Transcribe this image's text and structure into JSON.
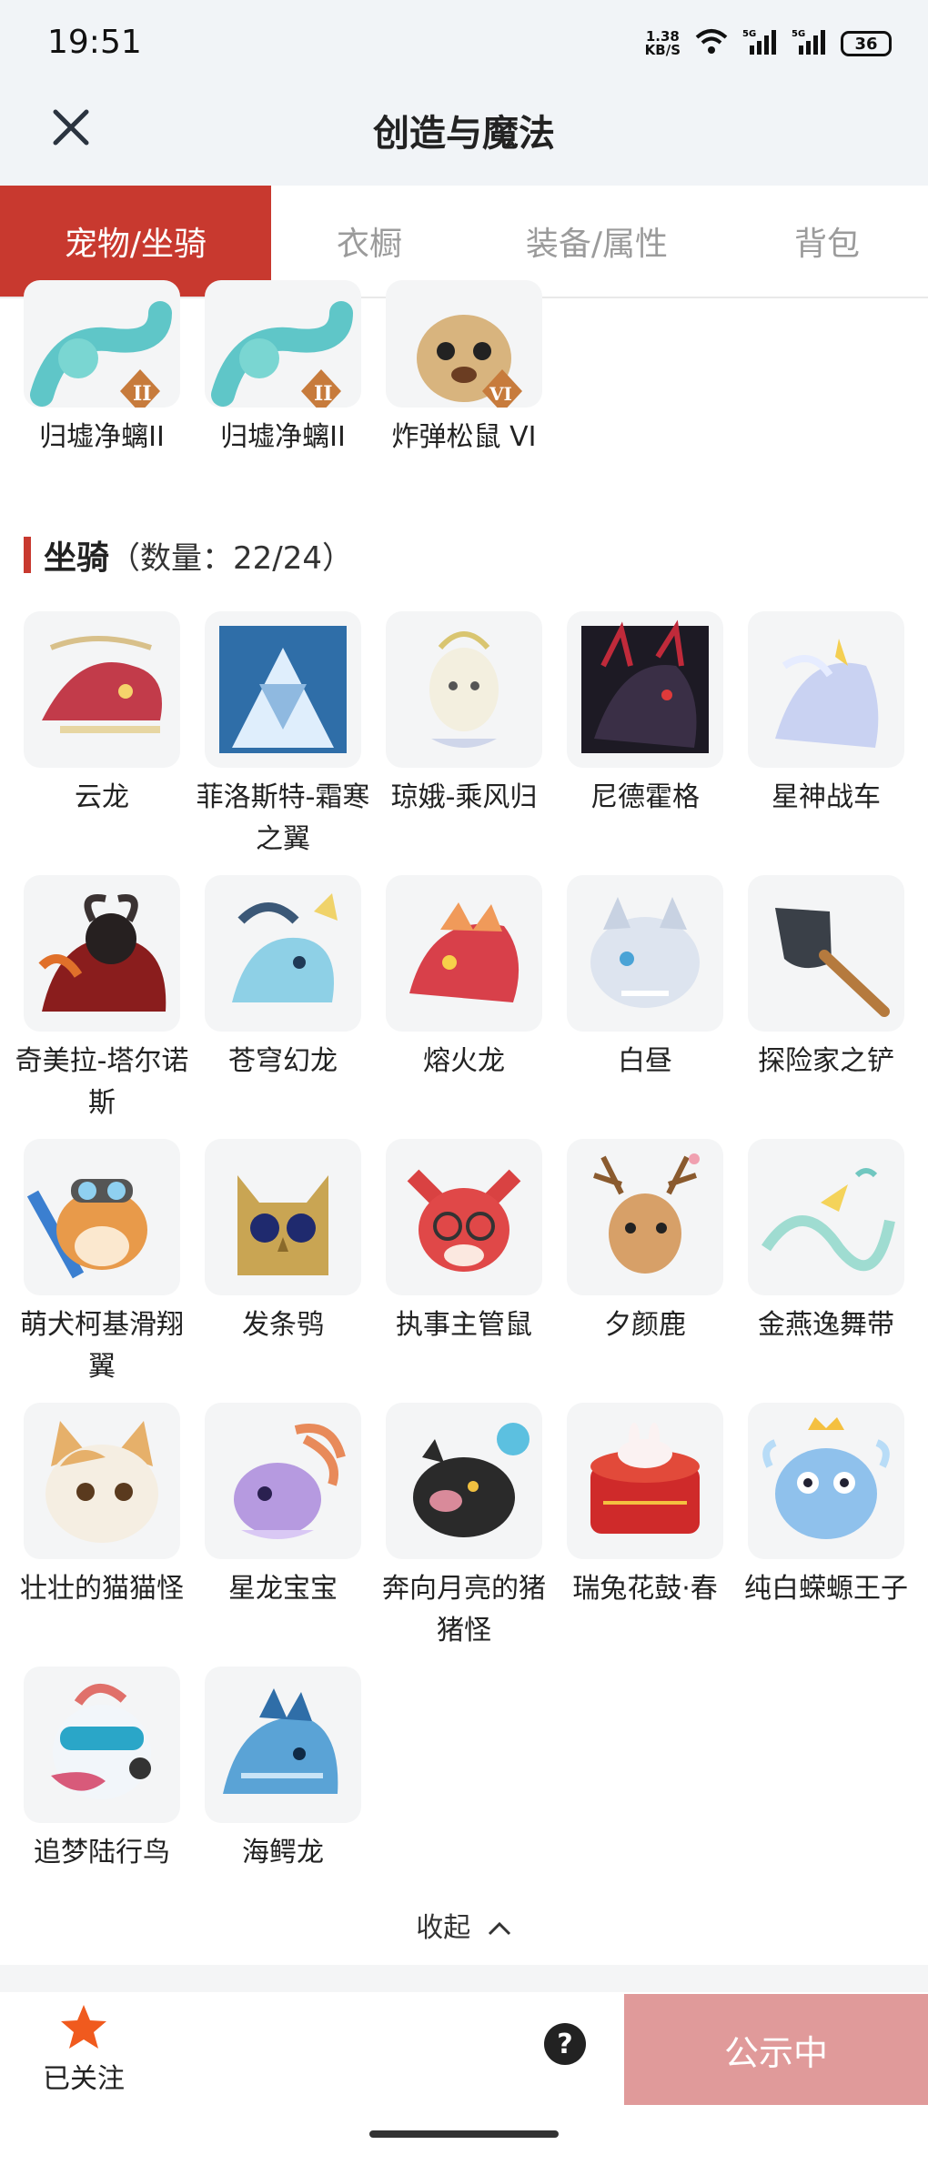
{
  "status": {
    "time": "19:51",
    "speed_value": "1.38",
    "speed_unit": "KB/S",
    "battery": "36"
  },
  "nav": {
    "title": "创造与魔法"
  },
  "tabs": [
    {
      "label": "宠物/坐骑",
      "active": true
    },
    {
      "label": "衣橱",
      "active": false
    },
    {
      "label": "装备/属性",
      "active": false
    },
    {
      "label": "背包",
      "active": false
    }
  ],
  "pets_partial": [
    {
      "name": "归墟净螭II",
      "icon": "teal-dragon-badge-ii"
    },
    {
      "name": "归墟净螭II",
      "icon": "teal-dragon-badge-ii"
    },
    {
      "name": "炸弹松鼠 VI",
      "icon": "squirrel-badge-vi"
    }
  ],
  "mounts_section": {
    "title": "坐骑",
    "count_label": "（数量：22/24）"
  },
  "mounts": [
    {
      "name": "云龙",
      "icon": "cloud-dragon",
      "color": "#c23b4a"
    },
    {
      "name": "菲洛斯特-霜寒之翼",
      "icon": "frost-wing",
      "color": "#6fa6d6"
    },
    {
      "name": "琼娥-乘风归",
      "icon": "celestial-lady",
      "color": "#e8e2c8"
    },
    {
      "name": "尼德霍格",
      "icon": "dark-dragon",
      "color": "#2b2530"
    },
    {
      "name": "星神战车",
      "icon": "star-chariot",
      "color": "#b7c2ea"
    },
    {
      "name": "奇美拉-塔尔诺斯",
      "icon": "chimera",
      "color": "#7a1e1e"
    },
    {
      "name": "苍穹幻龙",
      "icon": "sky-dragon",
      "color": "#7cc7e2"
    },
    {
      "name": "熔火龙",
      "icon": "lava-dragon",
      "color": "#d8404a"
    },
    {
      "name": "白昼",
      "icon": "white-beast",
      "color": "#cfd8e6"
    },
    {
      "name": "探险家之铲",
      "icon": "shovel",
      "color": "#3a4048"
    },
    {
      "name": "萌犬柯基滑翔翼",
      "icon": "corgi",
      "color": "#e89a4a"
    },
    {
      "name": "发条鸮",
      "icon": "clockwork-owl",
      "color": "#c9a553"
    },
    {
      "name": "执事主管鼠",
      "icon": "butler-rat",
      "color": "#d94242"
    },
    {
      "name": "夕颜鹿",
      "icon": "deer",
      "color": "#d7a068"
    },
    {
      "name": "金燕逸舞带",
      "icon": "swallow-ribbon",
      "color": "#9fdcd1"
    },
    {
      "name": "壮壮的猫猫怪",
      "icon": "cat",
      "color": "#e6b06a"
    },
    {
      "name": "星龙宝宝",
      "icon": "star-dragon-baby",
      "color": "#b69ae0"
    },
    {
      "name": "奔向月亮的猪猪怪",
      "icon": "pig",
      "color": "#2a2a2a"
    },
    {
      "name": "瑞兔花鼓·春",
      "icon": "rabbit-drum",
      "color": "#cf2a2a"
    },
    {
      "name": "纯白蝾螈王子",
      "icon": "axolotl-prince",
      "color": "#8fc1ec"
    },
    {
      "name": "追梦陆行鸟",
      "icon": "dream-bird",
      "color": "#d85a7a"
    },
    {
      "name": "海鳄龙",
      "icon": "sea-croc-dragon",
      "color": "#5aa3d6"
    }
  ],
  "collapse_label": "收起",
  "bottom": {
    "follow_label": "已关注",
    "help": "?",
    "public_label": "公示中"
  },
  "colors": {
    "accent": "#c8392f",
    "public_btn": "#e09a9a",
    "star": "#f05a1e"
  }
}
